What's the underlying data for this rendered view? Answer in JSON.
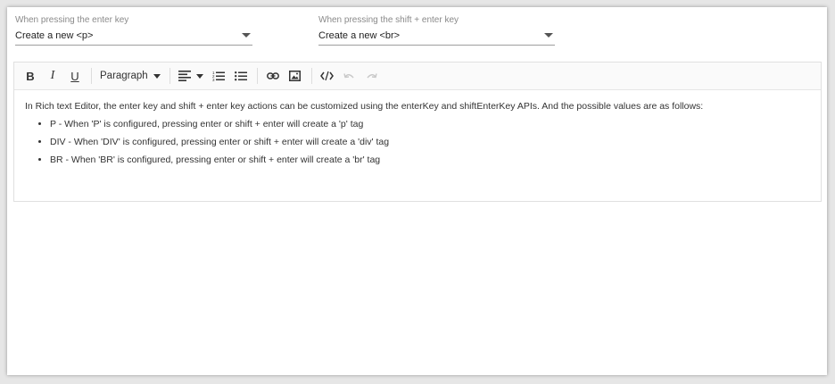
{
  "enter_key": {
    "label": "When pressing the enter key",
    "selected": "Create a new <p>"
  },
  "shift_enter_key": {
    "label": "When pressing the shift + enter key",
    "selected": "Create a new <br>"
  },
  "toolbar": {
    "bold": "B",
    "italic": "I",
    "underline": "U",
    "format": "Paragraph"
  },
  "content": {
    "intro": "In Rich text Editor, the enter key and shift + enter key actions can be customized using the enterKey and shiftEnterKey APIs. And the possible values are as follows:",
    "items": [
      "P - When 'P' is configured, pressing enter or shift + enter will create a 'p' tag",
      "DIV - When 'DIV' is configured, pressing enter or shift + enter will create a 'div' tag",
      "BR - When 'BR' is configured, pressing enter or shift + enter will create a 'br' tag"
    ]
  }
}
